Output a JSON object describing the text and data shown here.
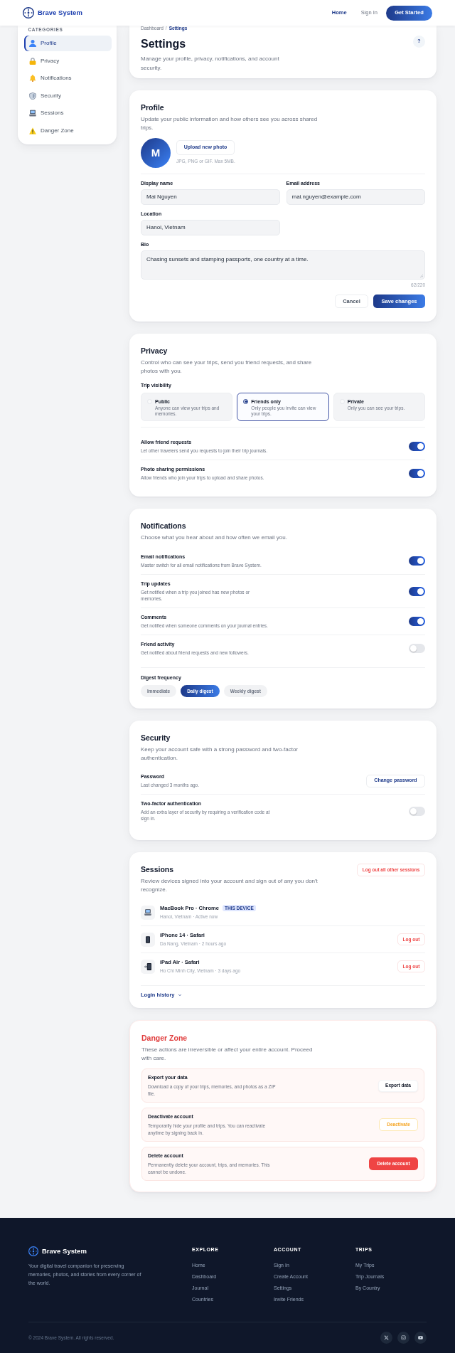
{
  "header": {
    "brand": "Brave System",
    "nav": [
      {
        "label": "Home",
        "selected": true
      },
      {
        "label": "Sign In",
        "selected": false
      }
    ],
    "cta": "Get Started"
  },
  "sidebar": {
    "heading": "CATEGORIES",
    "items": [
      {
        "label": "Profile",
        "selected": true
      },
      {
        "label": "Privacy",
        "selected": false
      },
      {
        "label": "Notifications",
        "selected": false
      },
      {
        "label": "Security",
        "selected": false
      },
      {
        "label": "Sessions",
        "selected": false
      },
      {
        "label": "Danger Zone",
        "selected": false
      }
    ]
  },
  "page_header": {
    "breadcrumb": [
      {
        "label": "Dashboard",
        "selected": false
      },
      {
        "label": "Settings",
        "selected": true
      }
    ],
    "separator": "/",
    "title": "Settings",
    "description": "Manage your profile, privacy, notifications, and account security.",
    "help_button": "?"
  },
  "profile": {
    "title": "Profile",
    "description": "Update your public information and how others see you across shared trips.",
    "avatar_initial": "M",
    "upload_button": "Upload new photo",
    "upload_hint": "JPG, PNG or GIF. Max 5MB.",
    "fields": [
      {
        "label": "Display name",
        "value": "Mai Nguyen"
      },
      {
        "label": "Email address",
        "value": "mai.nguyen@example.com"
      },
      {
        "label": "Location",
        "value": "Hanoi, Vietnam"
      }
    ],
    "bio": {
      "label": "Bio",
      "value": "Chasing sunsets and stamping passports, one country at a time.",
      "counter": "62/220"
    },
    "buttons": [
      {
        "label": "Cancel",
        "kind": "secondary"
      },
      {
        "label": "Save changes",
        "kind": "primary"
      }
    ]
  },
  "privacy": {
    "title": "Privacy",
    "description": "Control who can see your trips, send you friend requests, and share photos with you.",
    "visibility_label": "Trip visibility",
    "visibility_options": [
      {
        "label": "Public",
        "description": "Anyone can view your trips and memories.",
        "selected": false
      },
      {
        "label": "Friends only",
        "description": "Only people you invite can view your trips.",
        "selected": true
      },
      {
        "label": "Private",
        "description": "Only you can see your trips.",
        "selected": false
      }
    ],
    "toggles": [
      {
        "label": "Allow friend requests",
        "description": "Let other travelers send you requests to join their trip journals.",
        "on": true
      },
      {
        "label": "Photo sharing permissions",
        "description": "Allow friends who join your trips to upload and share photos.",
        "on": true
      }
    ]
  },
  "notifications": {
    "title": "Notifications",
    "description": "Choose what you hear about and how often we email you.",
    "toggles": [
      {
        "label": "Email notifications",
        "description": "Master switch for all email notifications from Brave System.",
        "on": true
      },
      {
        "label": "Trip updates",
        "description": "Get notified when a trip you joined has new photos or memories.",
        "on": true
      },
      {
        "label": "Comments",
        "description": "Get notified when someone comments on your journal entries.",
        "on": true
      },
      {
        "label": "Friend activity",
        "description": "Get notified about friend requests and new followers.",
        "on": false
      }
    ],
    "digest_label": "Digest frequency",
    "digest_options": [
      {
        "label": "Immediate",
        "selected": false
      },
      {
        "label": "Daily digest",
        "selected": true
      },
      {
        "label": "Weekly digest",
        "selected": false
      }
    ]
  },
  "security": {
    "title": "Security",
    "description": "Keep your account safe with a strong password and two-factor authentication.",
    "items": [
      {
        "kind": "action",
        "label": "Password",
        "description": "Last changed 3 months ago.",
        "button": "Change password"
      },
      {
        "kind": "toggle",
        "label": "Two-factor authentication",
        "description": "Add an extra layer of security by requiring a verification code at sign in.",
        "on": false
      }
    ]
  },
  "sessions": {
    "title": "Sessions",
    "description": "Review devices signed into your account and sign out of any you don't recognize.",
    "logout_all": "Log out all other sessions",
    "devices": [
      {
        "name": "MacBook Pro · Chrome",
        "badge": "THIS DEVICE",
        "detail": "Hanoi, Vietnam · Active now"
      },
      {
        "name": "iPhone 14 · Safari",
        "detail": "Da Nang, Vietnam · 2 hours ago",
        "action": "Log out"
      },
      {
        "name": "iPad Air · Safari",
        "detail": "Ho Chi Minh City, Vietnam · 3 days ago",
        "action": "Log out"
      }
    ],
    "login_history": {
      "label": "Login history",
      "expanded": false
    }
  },
  "danger_zone": {
    "title": "Danger Zone",
    "description": "These actions are irreversible or affect your entire account. Proceed with care.",
    "actions": [
      {
        "kind": "neutral",
        "label": "Export your data",
        "description": "Download a copy of your trips, memories, and photos as a ZIP file.",
        "button": "Export data"
      },
      {
        "kind": "warning",
        "label": "Deactivate account",
        "description": "Temporarily hide your profile and trips. You can reactivate anytime by signing back in.",
        "button": "Deactivate"
      },
      {
        "kind": "destructive",
        "label": "Delete account",
        "description": "Permanently delete your account, trips, and memories. This cannot be undone.",
        "button": "Delete account"
      }
    ]
  },
  "footer": {
    "brand": "Brave System",
    "tagline": "Your digital travel companion for preserving memories, photos, and stories from every corner of the world.",
    "columns": [
      {
        "heading": "EXPLORE",
        "links": [
          "Home",
          "Dashboard",
          "Journal",
          "Countries"
        ]
      },
      {
        "heading": "ACCOUNT",
        "links": [
          "Sign In",
          "Create Account",
          "Settings",
          "Invite Friends"
        ]
      },
      {
        "heading": "TRIPS",
        "links": [
          "My Trips",
          "Trip Journals",
          "By Country"
        ]
      }
    ],
    "copyright": "© 2024 Brave System. All rights reserved."
  }
}
